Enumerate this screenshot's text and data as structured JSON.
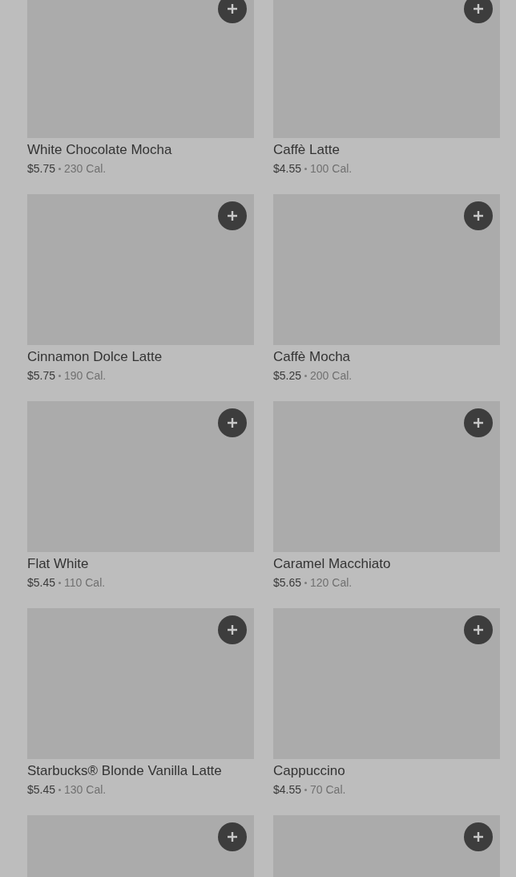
{
  "items": [
    {
      "kind": "product",
      "name": "White Chocolate Mocha",
      "price": "$5.75",
      "calories": "230 Cal."
    },
    {
      "kind": "product",
      "name": "Caffè Latte",
      "price": "$4.55",
      "calories": "100 Cal."
    },
    {
      "kind": "product",
      "name": "Cinnamon Dolce Latte",
      "price": "$5.75",
      "calories": "190 Cal."
    },
    {
      "kind": "product",
      "name": "Caffè Mocha",
      "price": "$5.25",
      "calories": "200 Cal."
    },
    {
      "kind": "product",
      "name": "Flat White",
      "price": "$5.45",
      "calories": "110 Cal."
    },
    {
      "kind": "product",
      "name": "Caramel Macchiato",
      "price": "$5.65",
      "calories": "120 Cal."
    },
    {
      "kind": "product",
      "name": "Starbucks® Blonde Vanilla Latte",
      "price": "$5.45",
      "calories": "130 Cal."
    },
    {
      "kind": "product",
      "name": "Cappuccino",
      "price": "$4.55",
      "calories": "70 Cal."
    },
    {
      "kind": "cut_off"
    },
    {
      "kind": "cut_off"
    }
  ]
}
